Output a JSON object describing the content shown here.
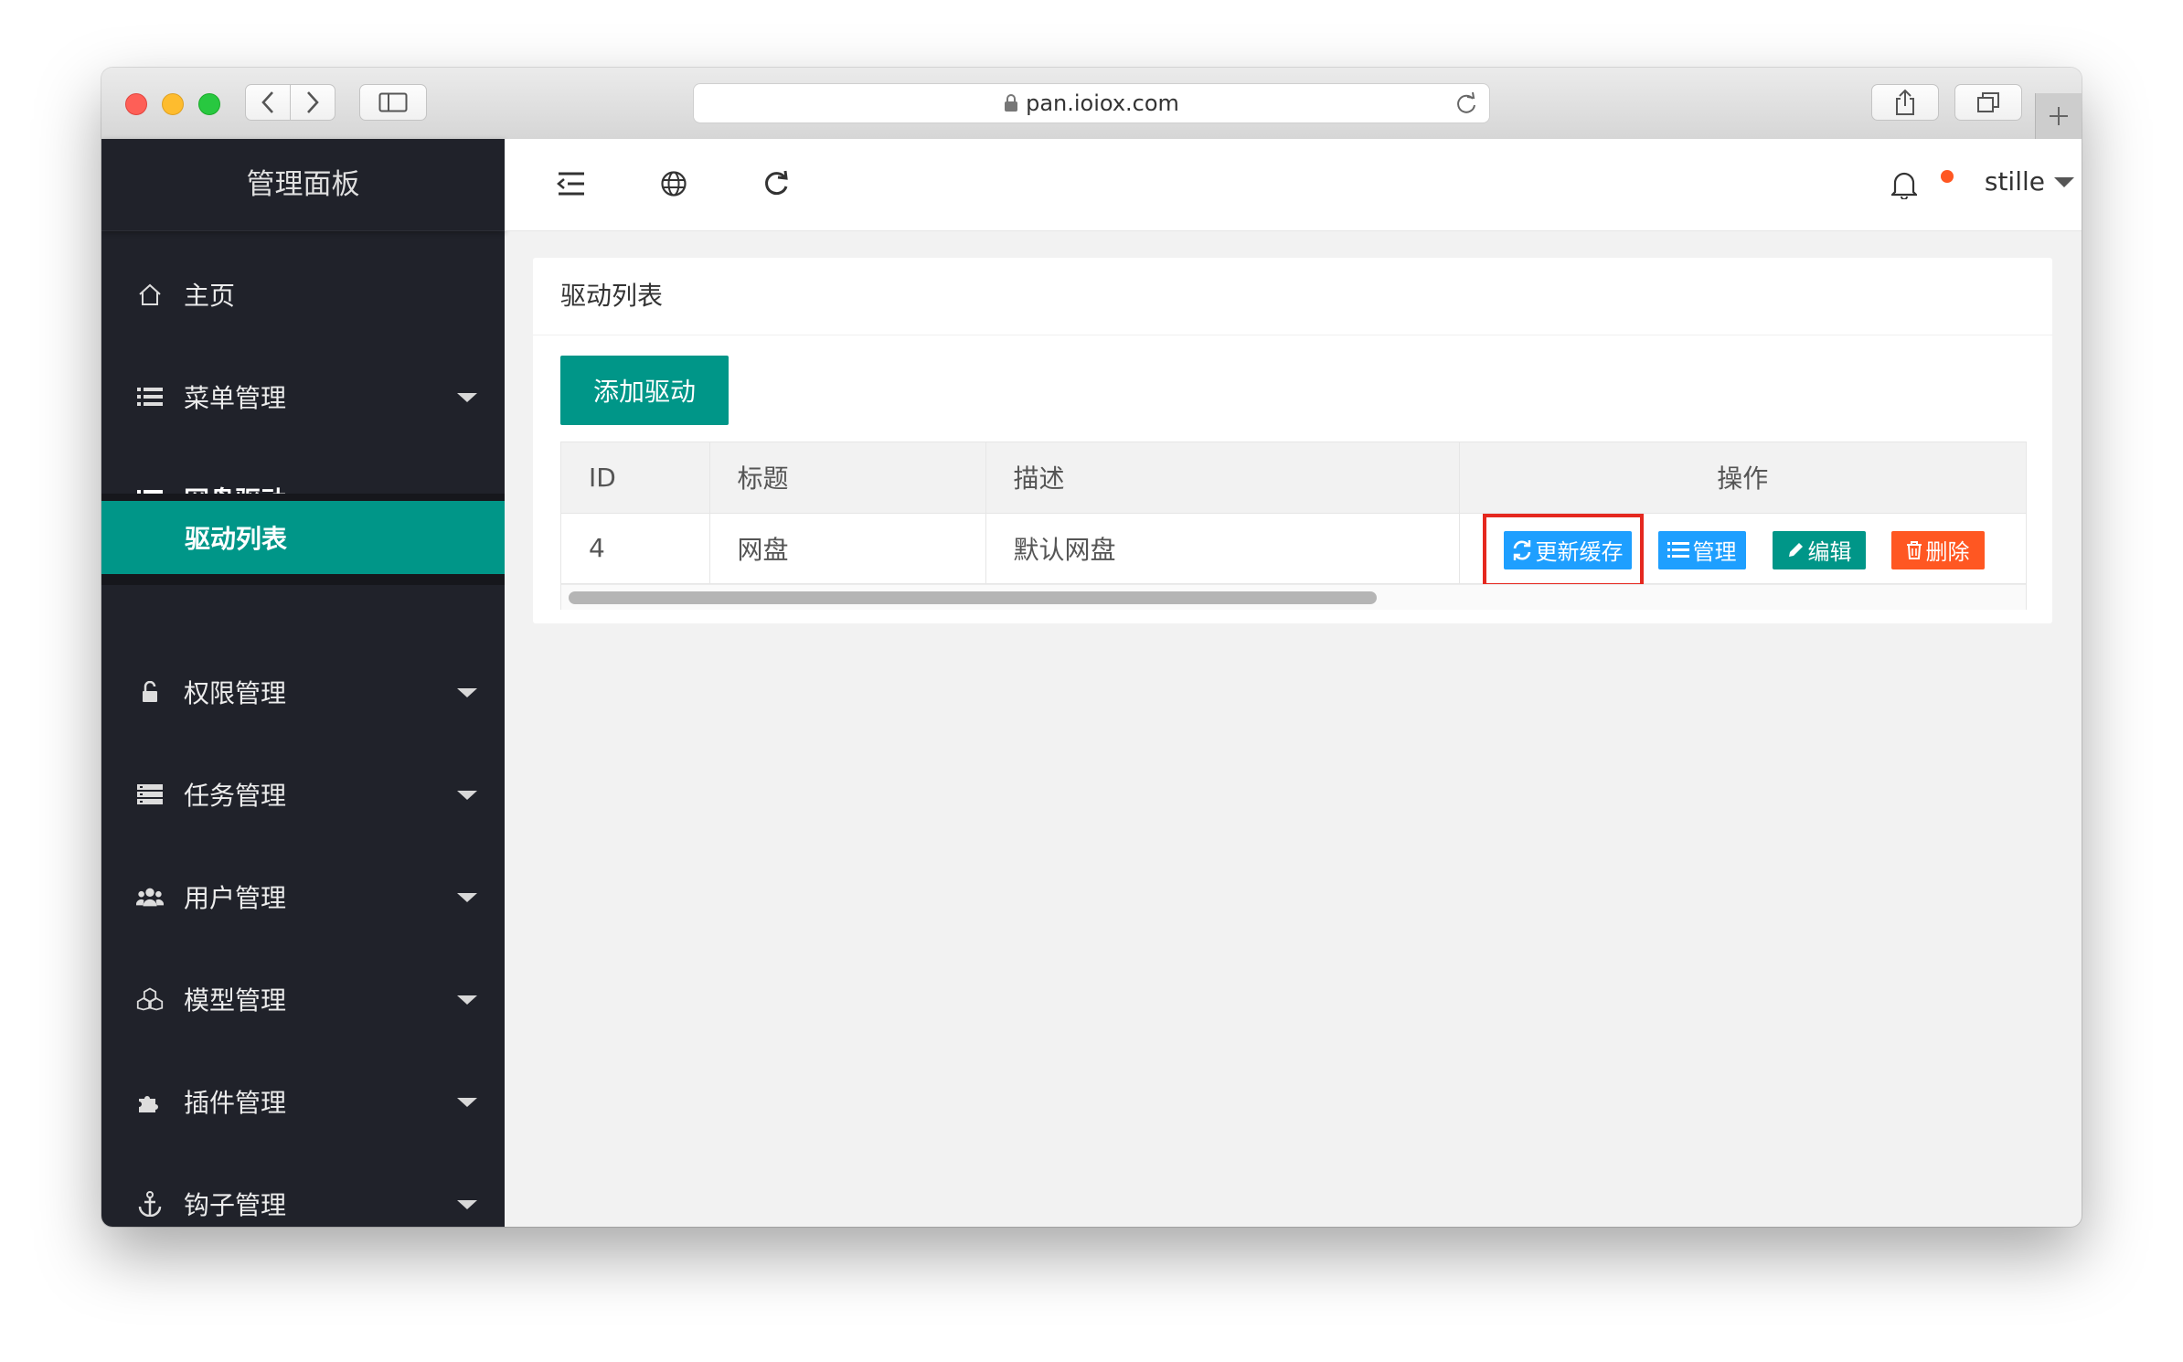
{
  "browser": {
    "url": "pan.ioiox.com"
  },
  "sidebar": {
    "logo": "管理面板",
    "items": [
      {
        "label": "主页",
        "icon": "home-icon"
      },
      {
        "label": "菜单管理",
        "icon": "list-icon"
      },
      {
        "label": "网盘驱动",
        "icon": "list-icon",
        "expanded": true
      },
      {
        "label": "权限管理",
        "icon": "lock-icon"
      },
      {
        "label": "任务管理",
        "icon": "server-icon"
      },
      {
        "label": "用户管理",
        "icon": "users-icon"
      },
      {
        "label": "模型管理",
        "icon": "cubes-icon"
      },
      {
        "label": "插件管理",
        "icon": "puzzle-icon"
      },
      {
        "label": "钩子管理",
        "icon": "anchor-icon"
      }
    ],
    "subitem": {
      "label": "驱动列表",
      "active": true
    }
  },
  "header": {
    "user": "stille"
  },
  "card": {
    "title": "驱动列表",
    "add_button": "添加驱动",
    "table": {
      "columns": [
        "ID",
        "标题",
        "描述",
        "操作"
      ],
      "rows": [
        {
          "id": "4",
          "title": "网盘",
          "desc": "默认网盘"
        }
      ],
      "actions": [
        "更新缓存",
        "管理",
        "编辑",
        "删除"
      ]
    }
  },
  "colors": {
    "sidebar_bg": "#20222a",
    "accent_teal": "#009688",
    "action_blue": "#1e9fff",
    "danger_orange": "#ff5722",
    "highlight_red": "#e5281f"
  }
}
